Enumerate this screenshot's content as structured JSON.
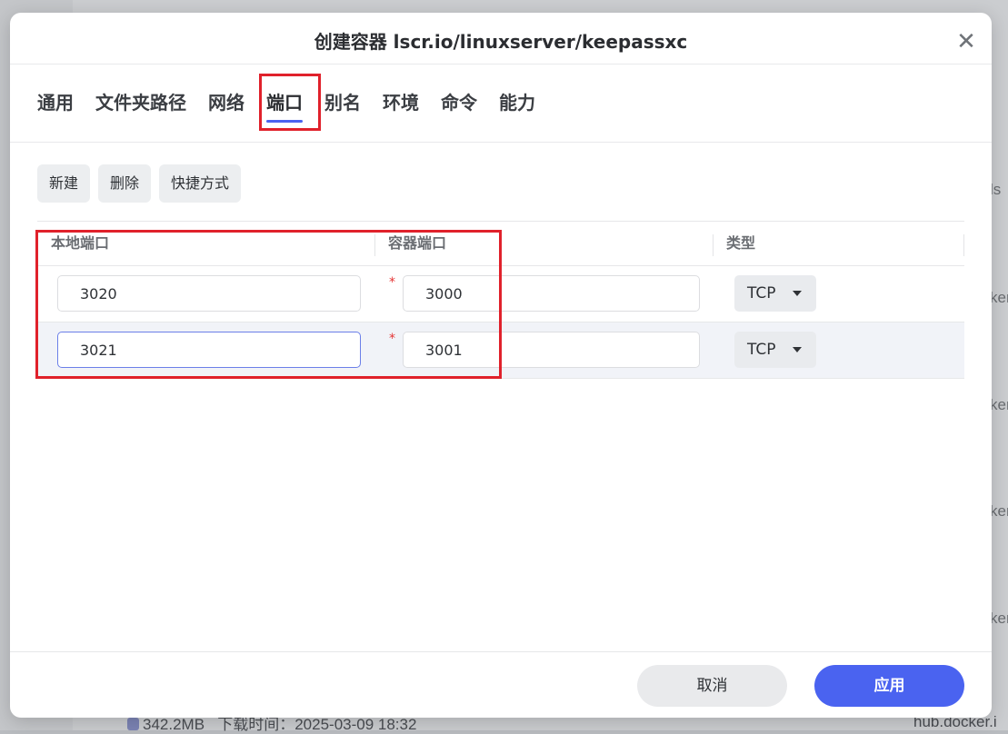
{
  "background": {
    "side_texts": [
      "ls",
      "ker.c",
      "ker.c",
      "ker.c",
      "ker.c"
    ],
    "footer": {
      "size": "342.2MB",
      "download_time": "下载时间：2025-03-09 18:32",
      "registry": "hub.docker.i"
    }
  },
  "dialog": {
    "title": "创建容器 lscr.io/linuxserver/keepassxc",
    "close_icon": "close-icon",
    "tabs": [
      {
        "label": "通用"
      },
      {
        "label": "文件夹路径"
      },
      {
        "label": "网络"
      },
      {
        "label": "端口",
        "active": true
      },
      {
        "label": "别名"
      },
      {
        "label": "环境"
      },
      {
        "label": "命令"
      },
      {
        "label": "能力"
      }
    ],
    "toolbar": {
      "new": "新建",
      "delete": "删除",
      "shortcut": "快捷方式"
    },
    "table": {
      "headers": {
        "local_port": "本地端口",
        "container_port": "容器端口",
        "type": "类型"
      },
      "rows": [
        {
          "local_port": "3020",
          "required_mark": "*",
          "container_port": "3000",
          "type": "TCP"
        },
        {
          "local_port": "3021",
          "required_mark": "*",
          "container_port": "3001",
          "type": "TCP"
        }
      ]
    },
    "footer": {
      "cancel": "取消",
      "apply": "应用"
    }
  },
  "colors": {
    "accent": "#4a63f0",
    "annotation": "#e0212b",
    "required": "#e53535"
  }
}
